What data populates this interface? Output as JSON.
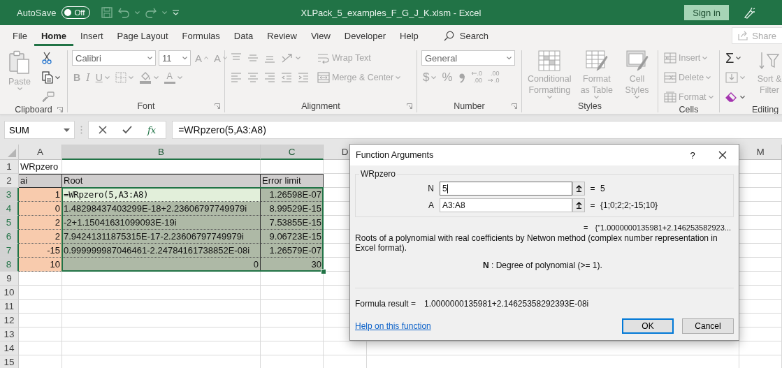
{
  "title_bar": {
    "autosave_label": "AutoSave",
    "autosave_toggle": {
      "label": "Off",
      "on": false
    },
    "title": "XLPack_5_examples_F_G_J_K.xlsm  -  Excel",
    "sign_in": "Sign in"
  },
  "tabs": [
    {
      "label": "File",
      "selected": false
    },
    {
      "label": "Home",
      "selected": true
    },
    {
      "label": "Insert",
      "selected": false
    },
    {
      "label": "Page Layout",
      "selected": false
    },
    {
      "label": "Formulas",
      "selected": false
    },
    {
      "label": "Data",
      "selected": false
    },
    {
      "label": "Review",
      "selected": false
    },
    {
      "label": "View",
      "selected": false
    },
    {
      "label": "Developer",
      "selected": false
    },
    {
      "label": "Help",
      "selected": false
    }
  ],
  "search": {
    "placeholder": "Search"
  },
  "share": "Share",
  "ribbon": {
    "groups": [
      {
        "label": "Clipboard",
        "launcher": true,
        "columns": [
          [
            {
              "kind": "paste",
              "label": "Paste",
              "caret": true,
              "disabled": true
            }
          ],
          [
            {
              "kind": "cut",
              "disabled": false
            },
            {
              "kind": "copy",
              "caret": true,
              "disabled": false
            },
            {
              "kind": "painter",
              "disabled": true
            }
          ]
        ]
      },
      {
        "label": "Font",
        "launcher": true,
        "columns": [
          [
            [
              {
                "kind": "font-name",
                "value": "Calibri",
                "disabled": true
              },
              {
                "kind": "font-size",
                "value": "11",
                "disabled": true
              },
              {
                "kind": "grow",
                "label": "A",
                "disabled": true
              },
              {
                "kind": "shrink",
                "label": "A",
                "disabled": true
              }
            ],
            [
              {
                "kind": "bold",
                "label": "B",
                "disabled": true
              },
              {
                "kind": "italic",
                "label": "I",
                "disabled": true
              },
              {
                "kind": "underline",
                "label": "U",
                "caret": true,
                "disabled": true
              },
              {
                "kind": "borders",
                "caret": true,
                "disabled": true
              },
              {
                "kind": "fill",
                "caret": true,
                "disabled": true
              },
              {
                "kind": "color",
                "label": "A",
                "caret": true,
                "disabled": true
              }
            ]
          ]
        ]
      },
      {
        "label": "Alignment",
        "launcher": true,
        "columns": [
          [
            [
              {
                "kind": "top",
                "disabled": true
              },
              {
                "kind": "middle",
                "disabled": true
              },
              {
                "kind": "bottom",
                "disabled": true
              },
              {
                "kind": "orientation",
                "caret": true,
                "disabled": true
              }
            ],
            [
              {
                "kind": "left",
                "disabled": true
              },
              {
                "kind": "center",
                "disabled": true
              },
              {
                "kind": "right",
                "disabled": true
              },
              {
                "kind": "outdent",
                "disabled": true
              },
              {
                "kind": "indent",
                "disabled": true
              }
            ]
          ],
          [
            {
              "kind": "wrap",
              "label": "Wrap Text",
              "disabled": true
            },
            {
              "kind": "merge",
              "label": "Merge & Center",
              "caret": true,
              "disabled": true
            }
          ]
        ]
      },
      {
        "label": "Number",
        "launcher": true,
        "columns": [
          [
            [
              {
                "kind": "format",
                "value": "General",
                "disabled": true
              }
            ],
            [
              {
                "kind": "currency",
                "label": "$",
                "caret": true,
                "disabled": true
              },
              {
                "kind": "percent",
                "label": "%",
                "disabled": true
              },
              {
                "kind": "comma",
                "disabled": true
              },
              {
                "kind": "increase-decimal",
                "lines": [
                  ".0",
                  ".00"
                ],
                "disabled": true
              },
              {
                "kind": "decrease-decimal",
                "lines": [
                  ".00",
                  ".0"
                ],
                "disabled": true
              }
            ]
          ]
        ]
      },
      {
        "label": "Styles",
        "launcher": false,
        "columns": [
          [
            {
              "kind": "conditional",
              "label": "Conditional Formatting",
              "caret": true,
              "disabled": true
            }
          ],
          [
            {
              "kind": "table",
              "label": "Format as Table",
              "caret": true,
              "disabled": true
            }
          ],
          [
            {
              "kind": "cell-styles",
              "label": "Cell Styles",
              "caret": true,
              "disabled": true
            }
          ]
        ]
      },
      {
        "label": "Cells",
        "launcher": false,
        "columns": [
          [
            {
              "kind": "insert",
              "label": "Insert",
              "caret": true,
              "disabled": true
            },
            {
              "kind": "delete",
              "label": "Delete",
              "caret": true,
              "disabled": true
            },
            {
              "kind": "format-cells",
              "label": "Format",
              "caret": true,
              "disabled": true
            }
          ]
        ]
      },
      {
        "label": "Editing",
        "launcher": false,
        "columns": [
          [
            {
              "kind": "sum",
              "label": "Σ",
              "caret": true,
              "disabled": false
            },
            {
              "kind": "fill-down",
              "caret": true,
              "disabled": true
            },
            {
              "kind": "clear",
              "caret": true,
              "disabled": false
            }
          ],
          [
            {
              "kind": "sort",
              "label": "Sort & Filter",
              "disabled": true
            }
          ]
        ]
      }
    ]
  },
  "formula_bar": {
    "name_box": "SUM",
    "fx": "fx",
    "formula": "=WRpzero(5,A3:A8)"
  },
  "sheet": {
    "columns": [
      {
        "label": "A",
        "selected": false
      },
      {
        "label": "B",
        "selected": true
      },
      {
        "label": "C",
        "selected": true
      },
      {
        "label": "D",
        "selected": false
      },
      {
        "label": "M",
        "selected": false
      }
    ],
    "rows": [
      {
        "number": "1",
        "selected": false,
        "cells": [
          {
            "text": "WRpzero",
            "kind": "text",
            "selected": false
          }
        ]
      },
      {
        "number": "2",
        "selected": false,
        "cells": [
          {
            "text": "ai",
            "kind": "header",
            "selected": false
          },
          {
            "text": "Root",
            "kind": "header",
            "selected": false
          },
          {
            "text": "Error limit",
            "kind": "header",
            "selected": false
          }
        ]
      },
      {
        "number": "3",
        "selected": true,
        "cells": [
          {
            "text": "1",
            "kind": "input",
            "selected": false
          },
          {
            "text": "=WRpzero(5,A3:A8)",
            "kind": "formula",
            "selected": true
          },
          {
            "text": "1.26598E-07",
            "kind": "number",
            "selected": true
          }
        ]
      },
      {
        "number": "4",
        "selected": true,
        "cells": [
          {
            "text": "0",
            "kind": "input",
            "selected": false
          },
          {
            "text": "1.48298437403299E-18+2.23606797749979i",
            "kind": "text",
            "selected": true
          },
          {
            "text": "8.99529E-15",
            "kind": "number",
            "selected": true
          }
        ]
      },
      {
        "number": "5",
        "selected": true,
        "cells": [
          {
            "text": "2",
            "kind": "input",
            "selected": false
          },
          {
            "text": "-2+1.15041631099093E-19i",
            "kind": "text",
            "selected": true
          },
          {
            "text": "7.53855E-15",
            "kind": "number",
            "selected": true
          }
        ]
      },
      {
        "number": "6",
        "selected": true,
        "cells": [
          {
            "text": "2",
            "kind": "input",
            "selected": false
          },
          {
            "text": "7.94241311875315E-17-2.23606797749979i",
            "kind": "text",
            "selected": true
          },
          {
            "text": "9.06723E-15",
            "kind": "number",
            "selected": true
          }
        ]
      },
      {
        "number": "7",
        "selected": true,
        "cells": [
          {
            "text": "-15",
            "kind": "input",
            "selected": false
          },
          {
            "text": "0.999999987046461-2.24784161738852E-08i",
            "kind": "text",
            "selected": true
          },
          {
            "text": "1.26579E-07",
            "kind": "number",
            "selected": true
          }
        ]
      },
      {
        "number": "8",
        "selected": true,
        "cells": [
          {
            "text": "10",
            "kind": "input",
            "selected": false
          },
          {
            "text": "0",
            "kind": "number",
            "selected": true
          },
          {
            "text": "30",
            "kind": "number",
            "selected": true
          }
        ]
      },
      {
        "number": "9",
        "selected": false
      },
      {
        "number": "10",
        "selected": false
      },
      {
        "number": "11",
        "selected": false
      },
      {
        "number": "12",
        "selected": false
      },
      {
        "number": "13",
        "selected": false
      },
      {
        "number": "14",
        "selected": false
      },
      {
        "number": "15",
        "selected": false
      }
    ]
  },
  "dialog": {
    "title": "Function Arguments",
    "help": "?",
    "function_name": "WRpzero",
    "arguments": [
      {
        "name": "N",
        "value": "5",
        "equals": "=",
        "result": "5",
        "focused": true
      },
      {
        "name": "A",
        "value": "A3:A8",
        "equals": "=",
        "result": "{1;0;2;2;-15;10}",
        "focused": false
      }
    ],
    "result_equals": "=",
    "result_preview": "{\"1.0000000135981+2.146253582923...",
    "description": "Roots of a polynomial with real coefficients by Netwon method (complex number representation in Excel format).",
    "argument_help": "**N**   : Degree of polynomial (>= 1).",
    "formula_result_label": "Formula result =",
    "formula_result": "1.0000000135981+2.14625358292393E-08i",
    "help_link": "Help on this function",
    "buttons": [
      {
        "label": "OK",
        "default": true
      },
      {
        "label": "Cancel",
        "default": false
      }
    ]
  }
}
